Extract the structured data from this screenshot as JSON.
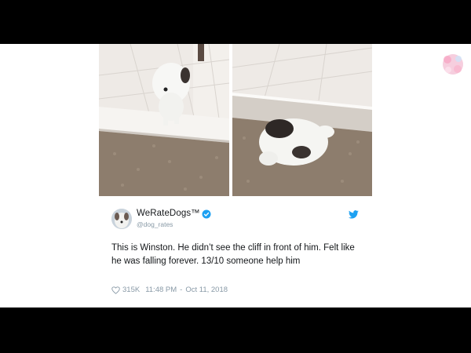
{
  "tweet": {
    "display_name": "WeRateDogs™",
    "handle": "@dog_rates",
    "text": "This is Winston. He didn’t see the cliff in front of him. Felt like he was falling forever. 13/10 someone help him",
    "likes": "315K",
    "time": "11:48 PM",
    "separator": "-",
    "date": "Oct 11, 2018"
  },
  "icons": {
    "verified": "verified-badge-icon",
    "platform": "twitter-bird-icon",
    "likes": "heart-icon",
    "channel_logo": "channel-logo-icon"
  },
  "colors": {
    "accent": "#1da1f2",
    "text": "#14171a",
    "muted": "#8899a6",
    "letterbox": "#000000"
  }
}
